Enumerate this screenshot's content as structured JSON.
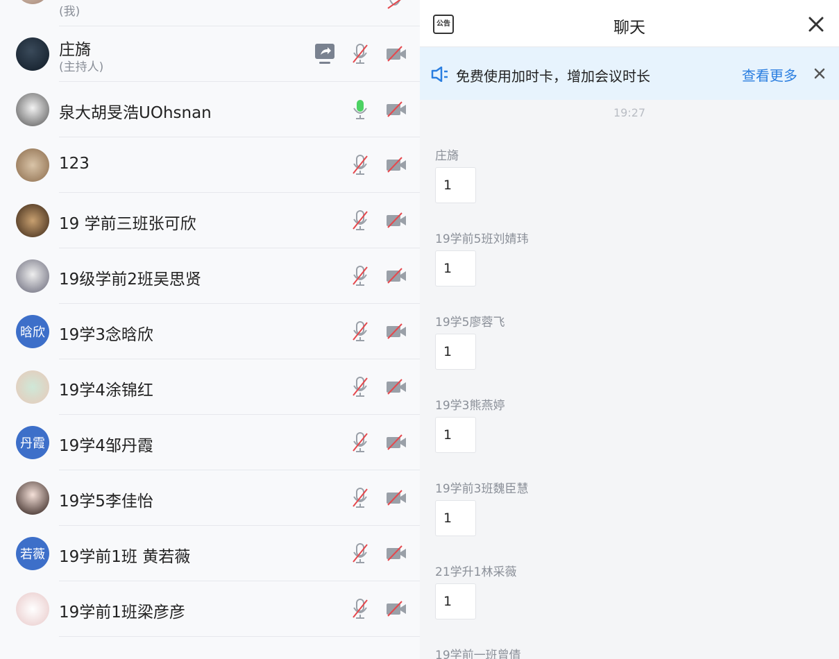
{
  "participants": {
    "self": {
      "role": "(我)"
    },
    "items": [
      {
        "name": "庄旖",
        "role": "(主持人)",
        "avatar": "photo"
      },
      {
        "name": "泉大胡旻浩UOhsnan",
        "avatar": "photo",
        "mic": "on"
      },
      {
        "name": "123",
        "avatar": "photo"
      },
      {
        "name": "19 学前三班张可欣",
        "avatar": "photo"
      },
      {
        "name": "19级学前2班吴思贤",
        "avatar": "photo"
      },
      {
        "name": "19学3念晗欣",
        "avatar_text": "晗欣"
      },
      {
        "name": "19学4涂锦红",
        "avatar": "photo"
      },
      {
        "name": "19学4邹丹霞",
        "avatar_text": "丹霞"
      },
      {
        "name": "19学5李佳怡",
        "avatar": "photo"
      },
      {
        "name": "19学前1班 黄若薇",
        "avatar_text": "若薇"
      },
      {
        "name": "19学前1班梁彦彦",
        "avatar": "photo"
      }
    ],
    "icons": {
      "share": "screen-share-icon",
      "mic_muted": "mic-muted-icon",
      "mic_on": "mic-on-icon",
      "camera_off": "camera-off-icon"
    },
    "colors": {
      "mic_on": "#4cd263",
      "muted": "#e5484d",
      "avatar_blue": "#3d6fc9"
    }
  },
  "chat": {
    "title": "聊天",
    "notice_icon_text": "公告",
    "close_icon": "close-icon",
    "banner": {
      "text": "免费使用加时卡，增加会议时长",
      "link": "查看更多",
      "icon": "speaker-icon"
    },
    "time": "19:27",
    "messages": [
      {
        "sender": "庄旖",
        "text": "1"
      },
      {
        "sender": "19学前5班刘婧玮",
        "text": "1"
      },
      {
        "sender": "19学5廖蓉飞",
        "text": "1"
      },
      {
        "sender": "19学3熊燕婷",
        "text": "1"
      },
      {
        "sender": "19学前3班魏臣慧",
        "text": "1"
      },
      {
        "sender": "21学升1林采薇",
        "text": "1"
      },
      {
        "sender": "19学前一班曾倩",
        "text": ""
      }
    ],
    "colors": {
      "link": "#2a7ee0",
      "banner_bg": "#e7f3fd"
    }
  }
}
